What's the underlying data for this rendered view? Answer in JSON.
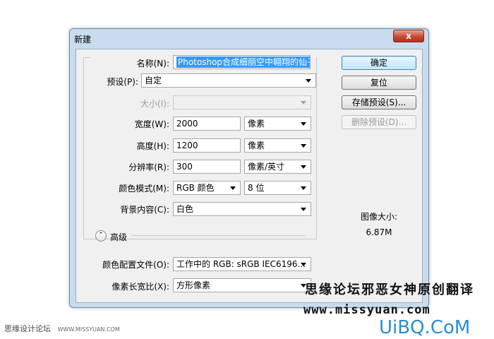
{
  "dialog": {
    "title": "新建",
    "close_label": "x"
  },
  "fields": {
    "name_label": "名称(N):",
    "name_value": "Photoshop合成细丽空中翱翔的仙子",
    "preset_label": "预设(P):",
    "preset_value": "自定",
    "size_label": "大小(I):",
    "size_value": "",
    "width_label": "宽度(W):",
    "width_value": "2000",
    "width_unit": "像素",
    "height_label": "高度(H):",
    "height_value": "1200",
    "height_unit": "像素",
    "resolution_label": "分辨率(R):",
    "resolution_value": "300",
    "resolution_unit": "像素/英寸",
    "color_mode_label": "颜色模式(M):",
    "color_mode_value": "RGB 颜色",
    "bit_depth_value": "8 位",
    "bg_label": "背景内容(C):",
    "bg_value": "白色",
    "advanced_label": "高级",
    "color_profile_label": "颜色配置文件(O):",
    "color_profile_value": "工作中的 RGB: sRGB IEC6196...",
    "pixel_aspect_label": "像素长宽比(X):",
    "pixel_aspect_value": "方形像素"
  },
  "buttons": {
    "ok": "确定",
    "reset": "复位",
    "save_preset": "存储预设(S)...",
    "delete_preset": "删除预设(D)..."
  },
  "image_size": {
    "label": "图像大小:",
    "value": "6.87M"
  },
  "watermarks": {
    "line1": "思缘论坛邪恶女神原创翻译",
    "line2": "www.missyuan.com",
    "line3": "UiBQ.CoM",
    "bottom_left": "思缘设计论坛",
    "bottom_left_small": "WWW.MISSYUAN.COM"
  }
}
